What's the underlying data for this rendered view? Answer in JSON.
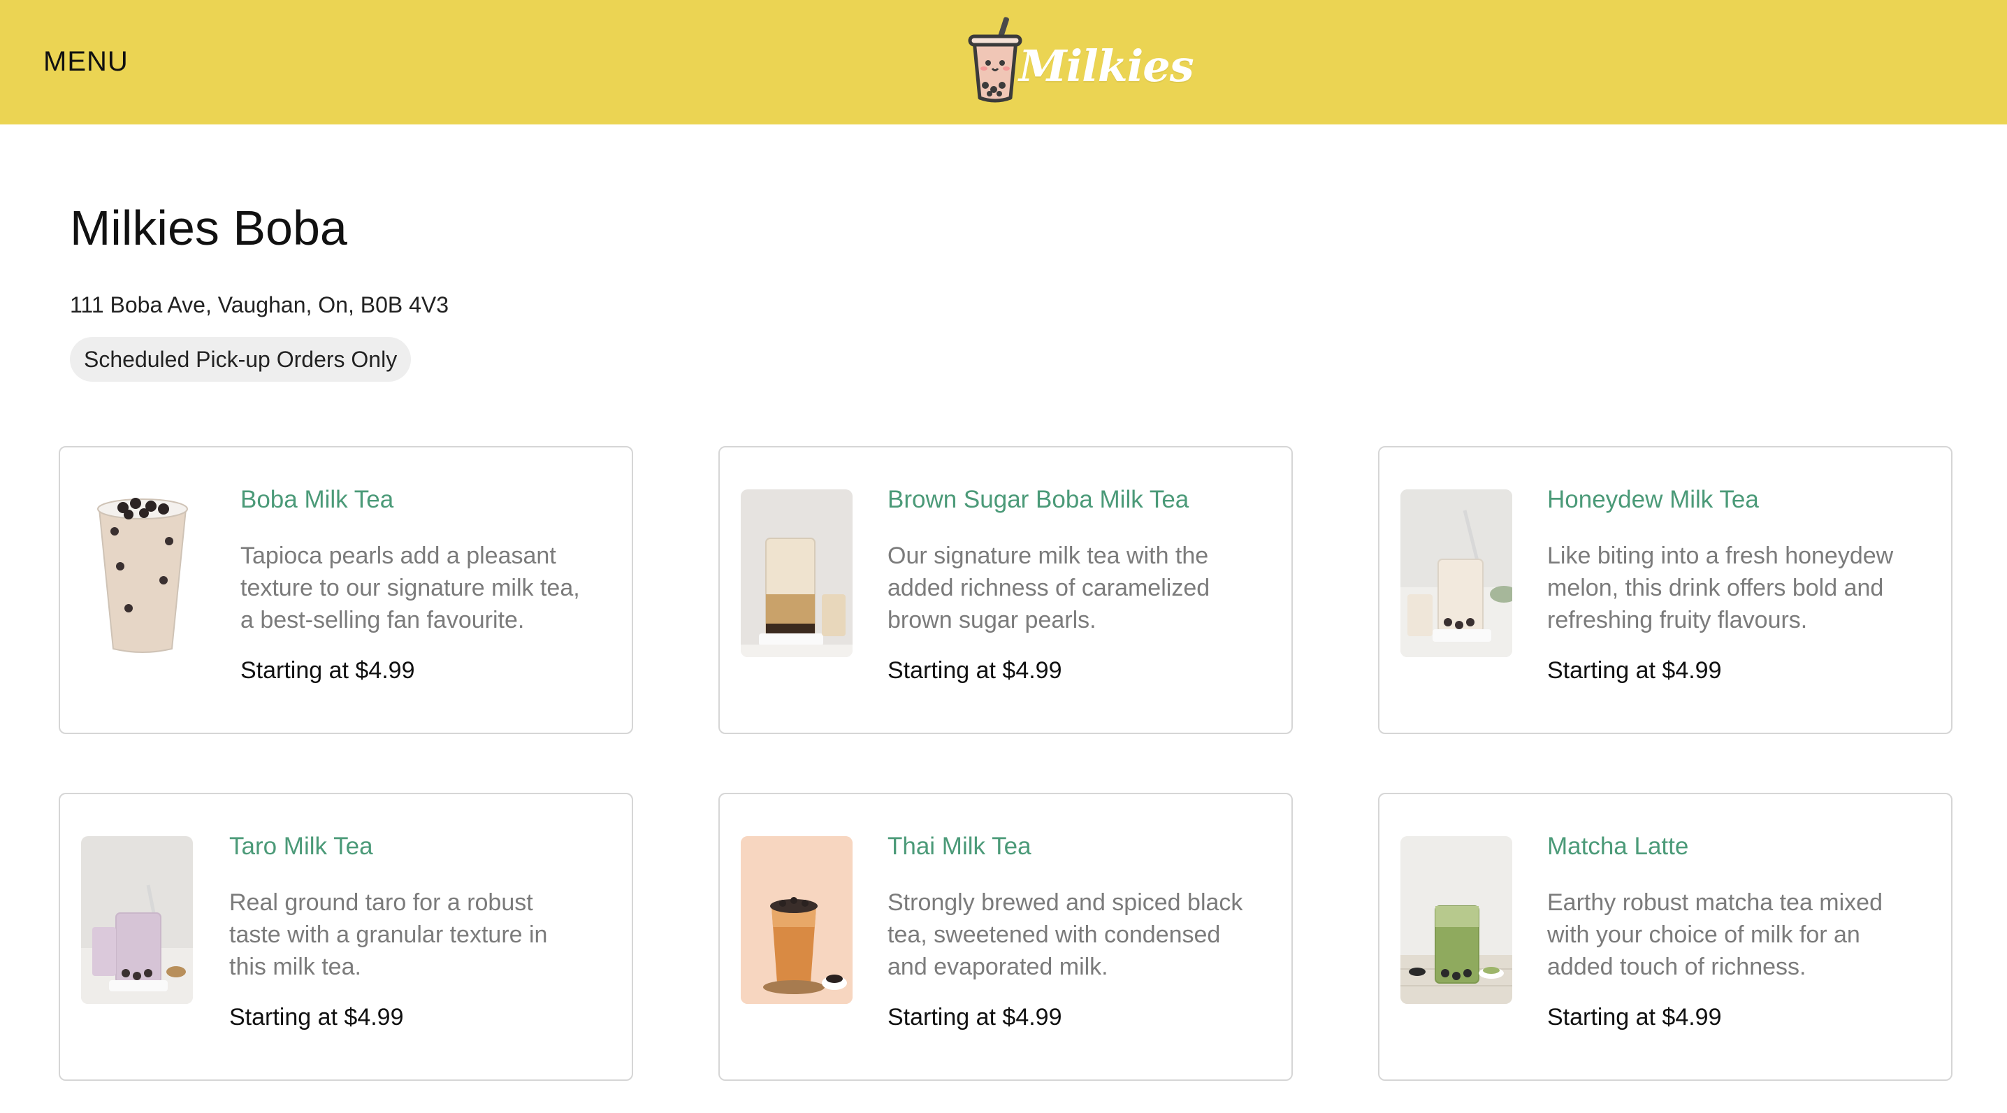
{
  "header": {
    "menu_label": "MENU",
    "logo_text": "Milkies",
    "background_color": "#ebd453"
  },
  "store": {
    "name": "Milkies Boba",
    "address": "111 Boba Ave, Vaughan, On, B0B 4V3",
    "order_badge": "Scheduled Pick-up Orders Only"
  },
  "colors": {
    "item_name": "#4b9a78",
    "description": "#7b7b7b",
    "card_border": "#d6d6d6"
  },
  "menu_items": [
    {
      "name": "Boba Milk Tea",
      "description": "Tapioca pearls add a pleasant texture to our signature milk tea, a best-selling fan favourite.",
      "price": "Starting at $4.99",
      "image": "boba-milk-tea-cup"
    },
    {
      "name": "Brown Sugar Boba Milk Tea",
      "description": "Our signature milk tea with the added richness of caramelized brown sugar pearls.",
      "price": "Starting at $4.99",
      "image": "brown-sugar-boba-glass"
    },
    {
      "name": "Honeydew Milk Tea",
      "description": "Like biting into a fresh honeydew melon, this drink offers bold and refreshing fruity flavours.",
      "price": "Starting at $4.99",
      "image": "honeydew-milk-tea-glass"
    },
    {
      "name": "Taro Milk Tea",
      "description": "Real ground taro for a robust taste with a granular texture in this milk tea.",
      "price": "Starting at $4.99",
      "image": "taro-milk-tea-glass"
    },
    {
      "name": "Thai Milk Tea",
      "description": "Strongly brewed and spiced black tea, sweetened with condensed and evaporated milk.",
      "price": "Starting at $4.99",
      "image": "thai-milk-tea-cup"
    },
    {
      "name": "Matcha Latte",
      "description": "Earthy robust matcha tea mixed with your choice of milk for an added touch of richness.",
      "price": "Starting at $4.99",
      "image": "matcha-latte-glass"
    }
  ]
}
